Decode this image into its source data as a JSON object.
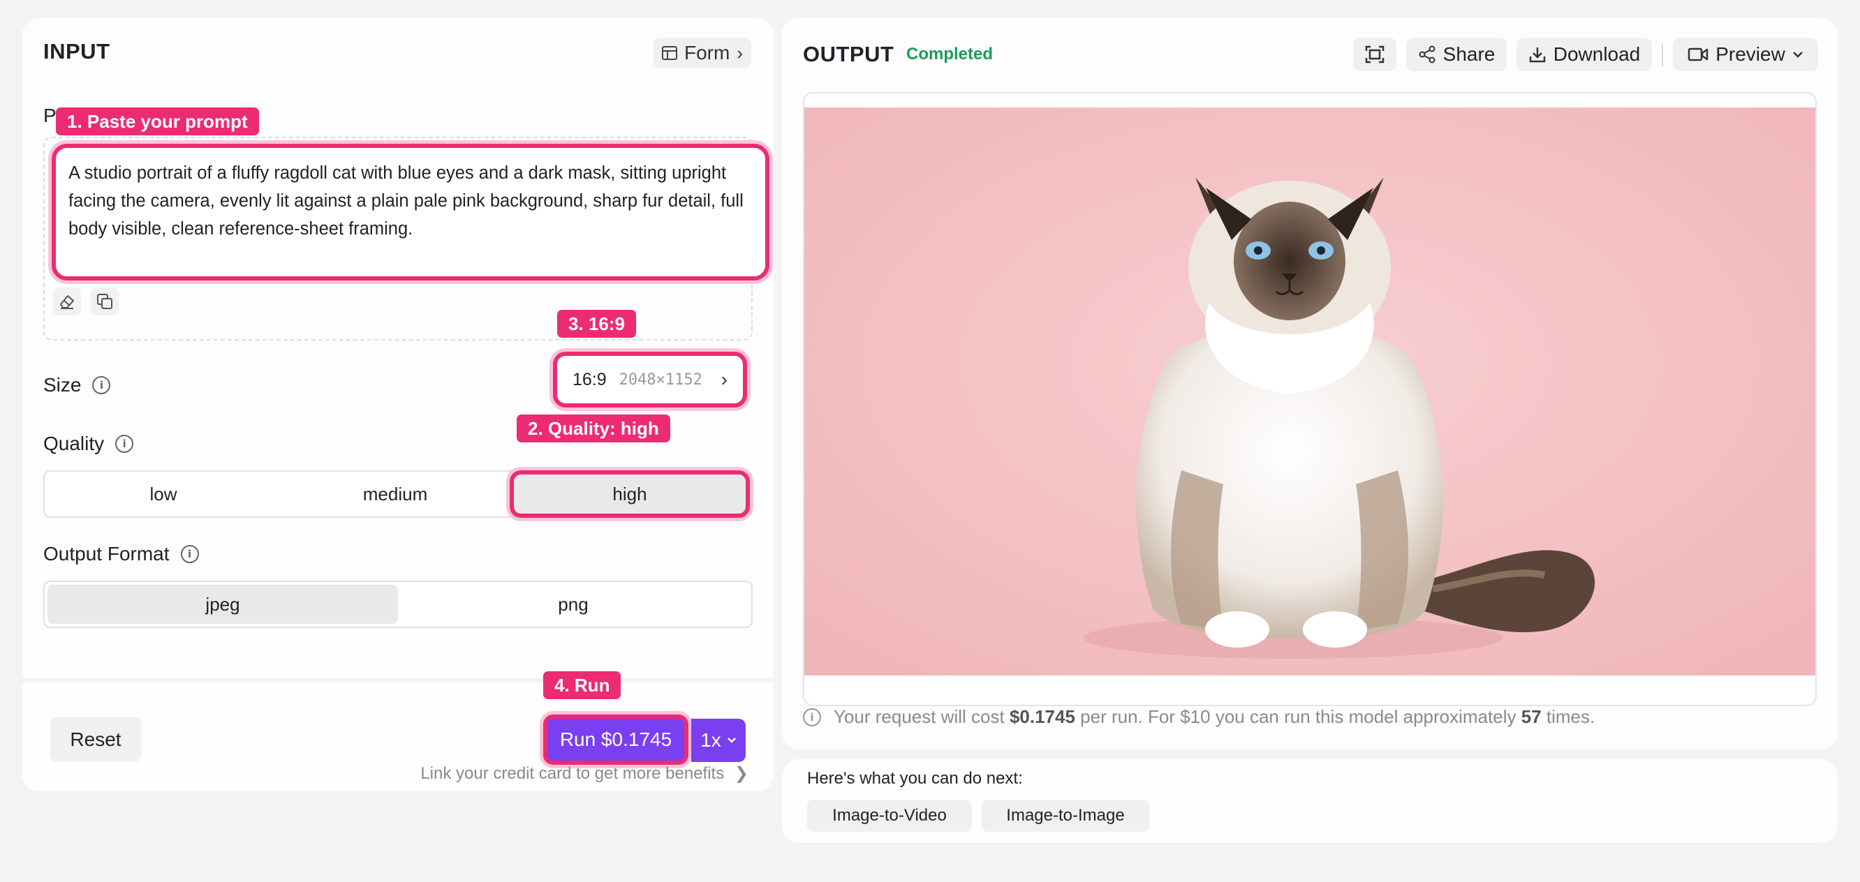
{
  "input": {
    "title": "INPUT",
    "form_button": "Form",
    "prompt_label": "Prompt",
    "prompt_value": "A studio portrait of a fluffy ragdoll cat with blue eyes and a dark mask, sitting upright facing the camera, evenly lit against a plain pale pink background, sharp fur detail, full body visible, clean reference-sheet framing.",
    "size": {
      "label": "Size",
      "ratio": "16:9",
      "dimensions": "2048×1152"
    },
    "quality": {
      "label": "Quality",
      "options": [
        "low",
        "medium",
        "high"
      ],
      "selected": "high"
    },
    "output_format": {
      "label": "Output Format",
      "options": [
        "jpeg",
        "png"
      ],
      "selected": "jpeg"
    },
    "reset_button": "Reset",
    "run_button": "Run $0.1745",
    "multiplier": "1x",
    "credit_link": "Link your credit card to get more benefits"
  },
  "annotations": {
    "step1": "1. Paste your prompt",
    "step2": "2. Quality: high",
    "step3": "3. 16:9",
    "step4": "4. Run"
  },
  "output": {
    "title": "OUTPUT",
    "status": "Completed",
    "share_button": "Share",
    "download_button": "Download",
    "preview_button": "Preview",
    "cost_prefix": "Your request will cost",
    "cost_value": "$0.1745",
    "cost_mid": "per run. For $10 you can run this model approximately",
    "cost_runs": "57",
    "cost_suffix": "times."
  },
  "next": {
    "title": "Here's what you can do next:",
    "actions": [
      "Image-to-Video",
      "Image-to-Image"
    ]
  },
  "colors": {
    "accent": "#7b3ff2",
    "annotation": "#ec2b73",
    "status": "#1a9c5b",
    "image_background": "#f5c3c6"
  }
}
